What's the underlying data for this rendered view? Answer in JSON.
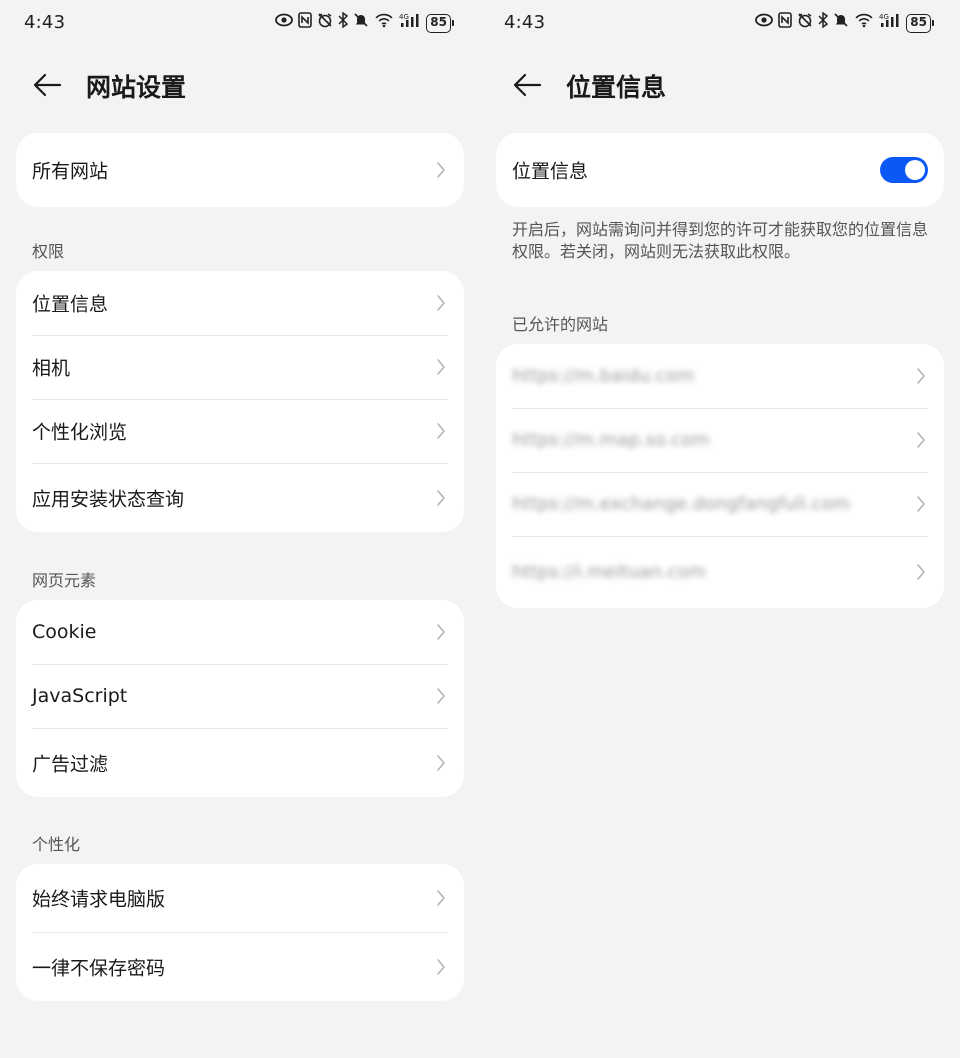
{
  "status_bar": {
    "time": "4:43",
    "battery": "85"
  },
  "left_screen": {
    "title": "网站设置",
    "all_sites": "所有网站",
    "permissions_section": "权限",
    "permissions": [
      {
        "label": "位置信息"
      },
      {
        "label": "相机"
      },
      {
        "label": "个性化浏览"
      },
      {
        "label": "应用安装状态查询"
      }
    ],
    "page_elements_section": "网页元素",
    "page_elements": [
      {
        "label": "Cookie"
      },
      {
        "label": "JavaScript"
      },
      {
        "label": "广告过滤"
      }
    ],
    "personalization_section": "个性化",
    "personalization": [
      {
        "label": "始终请求电脑版"
      },
      {
        "label": "一律不保存密码"
      }
    ]
  },
  "right_screen": {
    "title": "位置信息",
    "toggle_label": "位置信息",
    "toggle_on": true,
    "description": "开启后，网站需询问并得到您的许可才能获取您的位置信息权限。若关闭，网站则无法获取此权限。",
    "allowed_section": "已允许的网站",
    "allowed_sites": [
      {
        "url": "https://m.baidu.com"
      },
      {
        "url": "https://m.map.so.com"
      },
      {
        "url": "https://m.exchange.dongfangfuli.com"
      },
      {
        "url": "https://i.meituan.com"
      }
    ]
  },
  "colors": {
    "background": "#f1f3f5",
    "card": "#ffffff",
    "accent": "#0a59f7",
    "divider": "#e6e6e6",
    "secondary_text": "#555555"
  }
}
